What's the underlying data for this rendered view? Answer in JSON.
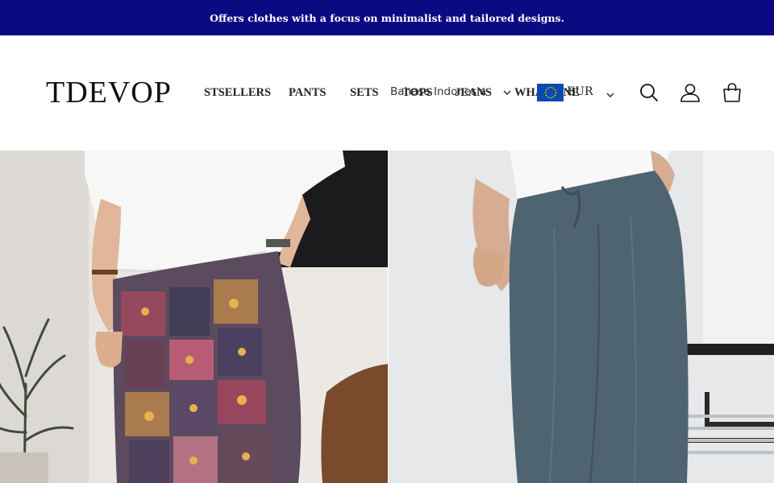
{
  "announcement": {
    "text": "Offers clothes with a focus on minimalist and tailored designs."
  },
  "brand": {
    "logo_text": "TDEVOP"
  },
  "nav": {
    "items": [
      {
        "label": "STSELLERS",
        "has_chevron": false
      },
      {
        "label": "PANTS",
        "has_chevron": false
      },
      {
        "label": "SETS",
        "has_chevron": false
      },
      {
        "label": "TOPS",
        "has_chevron": false
      },
      {
        "label": "JEANS",
        "has_chevron": true
      },
      {
        "label": "WHAT'S NE",
        "has_chevron": false
      }
    ],
    "language_selector": {
      "label": "Bahasa Indonesia"
    }
  },
  "currency": {
    "code": "EUR",
    "flag_icon": "eu-flag-icon"
  },
  "header_icons": [
    "search-icon",
    "account-icon",
    "cart-icon"
  ],
  "hero": {
    "left_image": "patterned-patchwork-pants-model",
    "right_image": "slate-tailored-pants-model"
  },
  "colors": {
    "announcement_bg": "#0a0a82",
    "announcement_text": "#ffffff",
    "header_bg": "#ffffff",
    "flag_blue": "#0a49b0",
    "flag_stars": "#ffd400"
  }
}
